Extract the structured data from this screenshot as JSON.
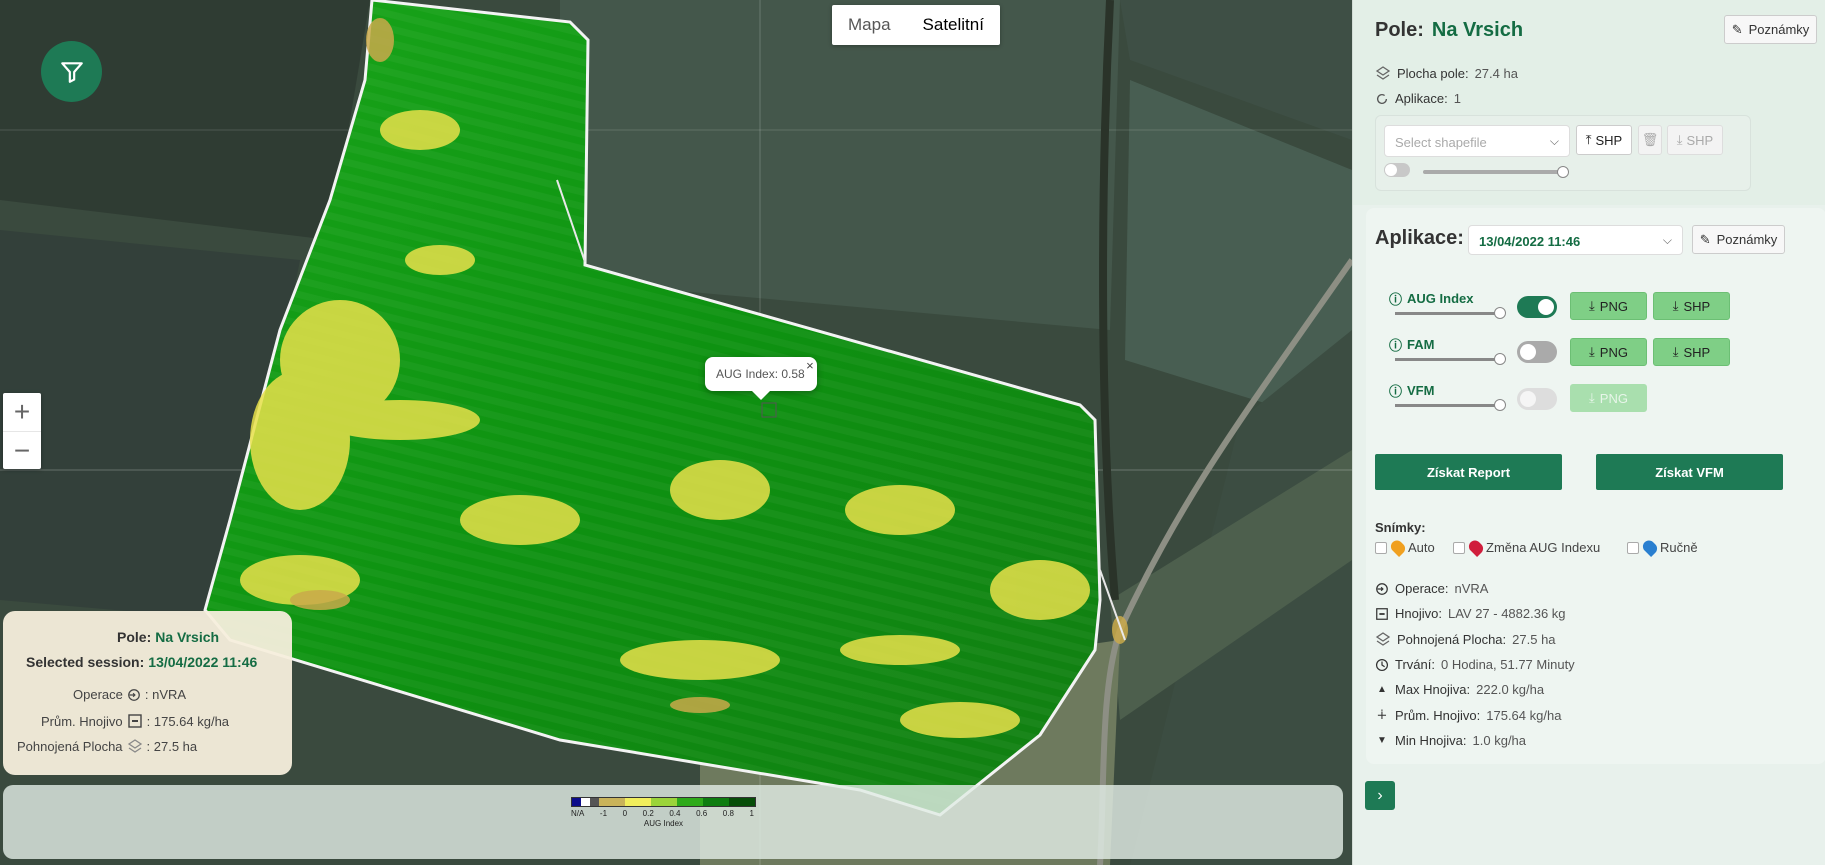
{
  "map": {
    "type_buttons": [
      "Mapa",
      "Satelitní"
    ],
    "active_type": "Satelitní",
    "zoom_in": "+",
    "zoom_out": "−",
    "popup_text": "AUG Index: 0.58",
    "popup_close": "×",
    "info": {
      "pole_label": "Pole:",
      "pole_value": "Na Vrsich",
      "session_label": "Selected session:",
      "session_value": "13/04/2022 11:46",
      "operace_label": "Operace",
      "operace_value": ": nVRA",
      "prum_label": "Prům. Hnojivo",
      "prum_value": ": 175.64 kg/ha",
      "plocha_label": "Pohnojená Plocha",
      "plocha_value": ": 27.5 ha"
    },
    "legend": {
      "ticks": [
        "N/A",
        "-1",
        "0",
        "0.2",
        "0.4",
        "0.6",
        "0.8",
        "1"
      ],
      "title": "AUG Index",
      "colors": [
        "#0c0c8a",
        "#ffffff",
        "#555555",
        "#c9b35a",
        "#f1ee5c",
        "#9bd43a",
        "#2eaa1a",
        "#0e7d10",
        "#074d08"
      ]
    }
  },
  "sidebar": {
    "pole_label": "Pole:",
    "pole_value": "Na Vrsich",
    "notes_label": "Poznámky",
    "plocha_label": "Plocha pole:",
    "plocha_value": "27.4 ha",
    "aplikace_count_label": "Aplikace:",
    "aplikace_count_value": "1",
    "shapefile_placeholder": "Select shapefile",
    "shp_upload": "SHP",
    "shp_download": "SHP",
    "aplikace_label": "Aplikace:",
    "aplikace_date": "13/04/2022 11:46",
    "notes2_label": "Poznámky",
    "layers": [
      {
        "name": "AUG Index",
        "state": "on",
        "png": "PNG",
        "shp": "SHP"
      },
      {
        "name": "FAM",
        "state": "off",
        "png": "PNG",
        "shp": "SHP"
      },
      {
        "name": "VFM",
        "state": "disabled",
        "png": "PNG"
      }
    ],
    "report_btn": "Získat Report",
    "vfm_btn": "Získat VFM",
    "snimky_label": "Snímky:",
    "snimky_opts": [
      "Auto",
      "Změna AUG Indexu",
      "Ručně"
    ],
    "stats": [
      {
        "label": "Operace:",
        "value": "nVRA"
      },
      {
        "label": "Hnojivo:",
        "value": "LAV 27 - 4882.36 kg"
      },
      {
        "label": "Pohnojená Plocha:",
        "value": "27.5 ha"
      },
      {
        "label": "Trvání:",
        "value": "0 Hodina, 51.77 Minuty"
      },
      {
        "label": "Max Hnojiva:",
        "value": "222.0 kg/ha"
      },
      {
        "label": "Prům. Hnojivo:",
        "value": "175.64 kg/ha"
      },
      {
        "label": "Min Hnojiva:",
        "value": "1.0 kg/ha"
      }
    ],
    "next_btn": "›",
    "colors": {
      "accent": "#1e7a55",
      "accent_text": "#146c43",
      "button_green": "#7fcf86"
    }
  }
}
